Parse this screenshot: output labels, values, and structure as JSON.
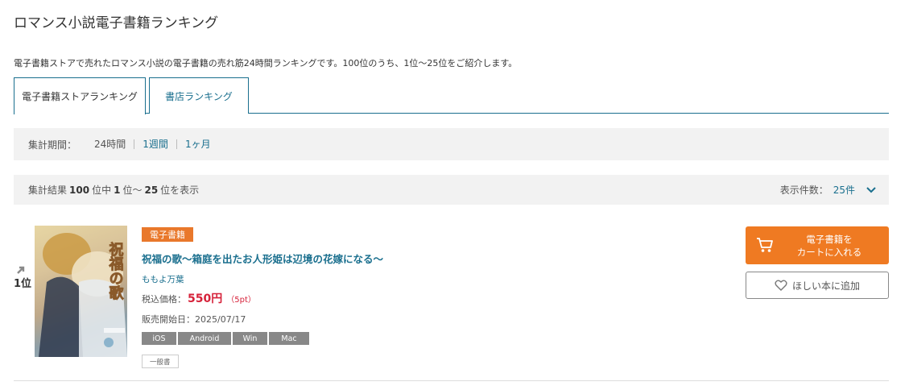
{
  "page": {
    "title": "ロマンス小説電子書籍ランキング",
    "description": "電子書籍ストアで売れたロマンス小説の電子書籍の売れ筋24時間ランキングです。100位のうち、1位〜25位をご紹介します。"
  },
  "tabs": [
    {
      "label": "電子書籍ストアランキング",
      "active": true
    },
    {
      "label": "書店ランキング",
      "active": false
    }
  ],
  "period": {
    "label": "集計期間：",
    "options": [
      "24時間",
      "1週間",
      "1ヶ月"
    ],
    "selected": "24時間"
  },
  "results": {
    "prefix": "集計結果",
    "total": "100",
    "mid1": "位中",
    "start": "1",
    "mid2": "位〜",
    "end": "25",
    "suffix": "位を表示",
    "per_page_label": "表示件数：",
    "per_page_value": "25件"
  },
  "item": {
    "rank": "1位",
    "badge": "電子書籍",
    "title": "祝福の歌〜箱庭を出たお人形姫は辺境の花嫁になる〜",
    "author": "ももよ万葉",
    "price_label": "税込価格：",
    "price": "550円",
    "points": "（5pt）",
    "release": "販売開始日：2025/07/17",
    "platforms": [
      "iOS",
      "Android",
      "Win",
      "Mac"
    ],
    "genre": "一般書",
    "cover_text": "祝福の歌",
    "cart_line1": "電子書籍を",
    "cart_line2": "カートに入れる",
    "wishlist": "ほしい本に追加"
  },
  "colors": {
    "accent": "#1a6f8e",
    "orange": "#ef7a22",
    "price": "#d6223a",
    "panel": "#f2f2f2"
  }
}
